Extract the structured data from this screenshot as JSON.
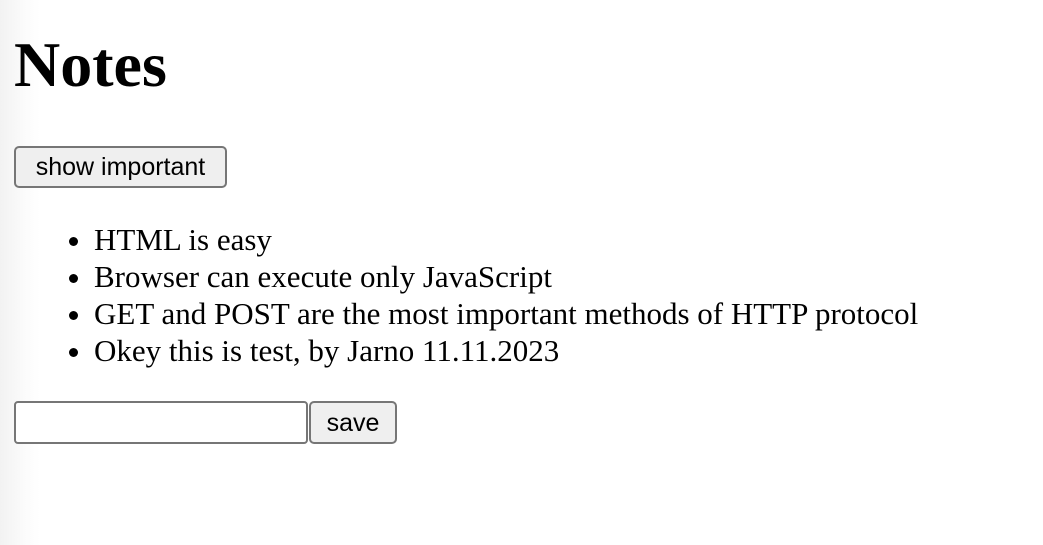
{
  "page": {
    "title": "Notes"
  },
  "toolbar": {
    "toggle_label": "show important"
  },
  "notes": [
    "HTML is easy",
    "Browser can execute only JavaScript",
    "GET and POST are the most important methods of HTTP protocol",
    "Okey this is test, by Jarno 11.11.2023"
  ],
  "form": {
    "input_value": "",
    "input_placeholder": "",
    "save_label": "save"
  }
}
